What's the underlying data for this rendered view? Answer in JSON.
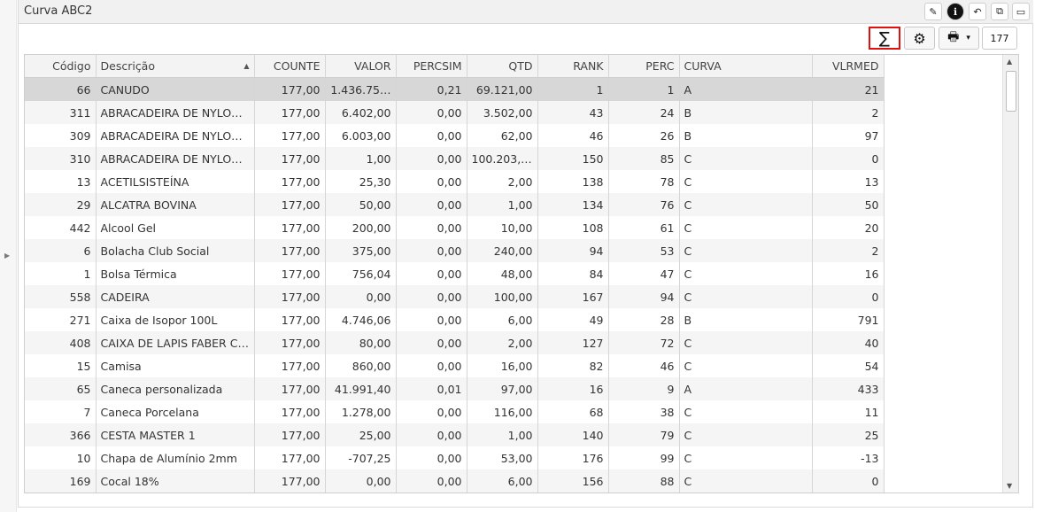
{
  "window": {
    "title": "Curva ABC2",
    "buttons": [
      {
        "name": "edit-icon",
        "glyph": "✎"
      },
      {
        "name": "info-icon",
        "glyph": "ℹ"
      },
      {
        "name": "undo-icon",
        "glyph": "↶"
      },
      {
        "name": "undock-icon",
        "glyph": "⧉"
      },
      {
        "name": "maximize-icon",
        "glyph": "▭"
      }
    ]
  },
  "toolbar": {
    "sum_glyph": "∑",
    "gear_glyph": "⚙",
    "print_glyph": "🖶",
    "dropdown_glyph": "▾",
    "record_count": "177"
  },
  "grid": {
    "columns": [
      {
        "key": "codigo",
        "label": "Código",
        "align": "r"
      },
      {
        "key": "descricao",
        "label": "Descrição",
        "align": "l",
        "sorted": "asc"
      },
      {
        "key": "counte",
        "label": "COUNTE",
        "align": "r"
      },
      {
        "key": "valor",
        "label": "VALOR",
        "align": "r"
      },
      {
        "key": "percsim",
        "label": "PERCSIM",
        "align": "r"
      },
      {
        "key": "qtd",
        "label": "QTD",
        "align": "r"
      },
      {
        "key": "rank",
        "label": "RANK",
        "align": "r"
      },
      {
        "key": "perc",
        "label": "PERC",
        "align": "r"
      },
      {
        "key": "curva",
        "label": "CURVA",
        "align": "l"
      },
      {
        "key": "vlrmed",
        "label": "VLRMED",
        "align": "r"
      }
    ],
    "selected_row": 0,
    "rows": [
      [
        "66",
        "CANUDO",
        "177,00",
        "1.436.75…",
        "0,21",
        "69.121,00",
        "1",
        "1",
        "A",
        "21"
      ],
      [
        "311",
        "ABRACADEIRA DE NYLON …",
        "177,00",
        "6.402,00",
        "0,00",
        "3.502,00",
        "43",
        "24",
        "B",
        "2"
      ],
      [
        "309",
        "ABRACADEIRA DE NYLON …",
        "177,00",
        "6.003,00",
        "0,00",
        "62,00",
        "46",
        "26",
        "B",
        "97"
      ],
      [
        "310",
        "ABRACADEIRA DE NYLON …",
        "177,00",
        "1,00",
        "0,00",
        "100.203,00",
        "150",
        "85",
        "C",
        "0"
      ],
      [
        "13",
        "ACETILSISTEÍNA",
        "177,00",
        "25,30",
        "0,00",
        "2,00",
        "138",
        "78",
        "C",
        "13"
      ],
      [
        "29",
        "ALCATRA BOVINA",
        "177,00",
        "50,00",
        "0,00",
        "1,00",
        "134",
        "76",
        "C",
        "50"
      ],
      [
        "442",
        "Alcool Gel",
        "177,00",
        "200,00",
        "0,00",
        "10,00",
        "108",
        "61",
        "C",
        "20"
      ],
      [
        "6",
        "Bolacha Club Social",
        "177,00",
        "375,00",
        "0,00",
        "240,00",
        "94",
        "53",
        "C",
        "2"
      ],
      [
        "1",
        "Bolsa Térmica",
        "177,00",
        "756,04",
        "0,00",
        "48,00",
        "84",
        "47",
        "C",
        "16"
      ],
      [
        "558",
        "CADEIRA",
        "177,00",
        "0,00",
        "0,00",
        "100,00",
        "167",
        "94",
        "C",
        "0"
      ],
      [
        "271",
        "Caixa de Isopor 100L",
        "177,00",
        "4.746,06",
        "0,00",
        "6,00",
        "49",
        "28",
        "B",
        "791"
      ],
      [
        "408",
        "CAIXA DE LAPIS FABER C…",
        "177,00",
        "80,00",
        "0,00",
        "2,00",
        "127",
        "72",
        "C",
        "40"
      ],
      [
        "15",
        "Camisa",
        "177,00",
        "860,00",
        "0,00",
        "16,00",
        "82",
        "46",
        "C",
        "54"
      ],
      [
        "65",
        "Caneca personalizada",
        "177,00",
        "41.991,40",
        "0,01",
        "97,00",
        "16",
        "9",
        "A",
        "433"
      ],
      [
        "7",
        "Caneca Porcelana",
        "177,00",
        "1.278,00",
        "0,00",
        "116,00",
        "68",
        "38",
        "C",
        "11"
      ],
      [
        "366",
        "CESTA MASTER 1",
        "177,00",
        "25,00",
        "0,00",
        "1,00",
        "140",
        "79",
        "C",
        "25"
      ],
      [
        "10",
        "Chapa de Alumínio 2mm",
        "177,00",
        "-707,25",
        "0,00",
        "53,00",
        "176",
        "99",
        "C",
        "-13"
      ],
      [
        "169",
        "Cocal 18%",
        "177,00",
        "0,00",
        "0,00",
        "6,00",
        "156",
        "88",
        "C",
        "0"
      ]
    ]
  },
  "colors": {
    "highlight_border": "#e01010",
    "selected_row": "#d7d7d7",
    "header_bg": "#f3f3f3"
  }
}
